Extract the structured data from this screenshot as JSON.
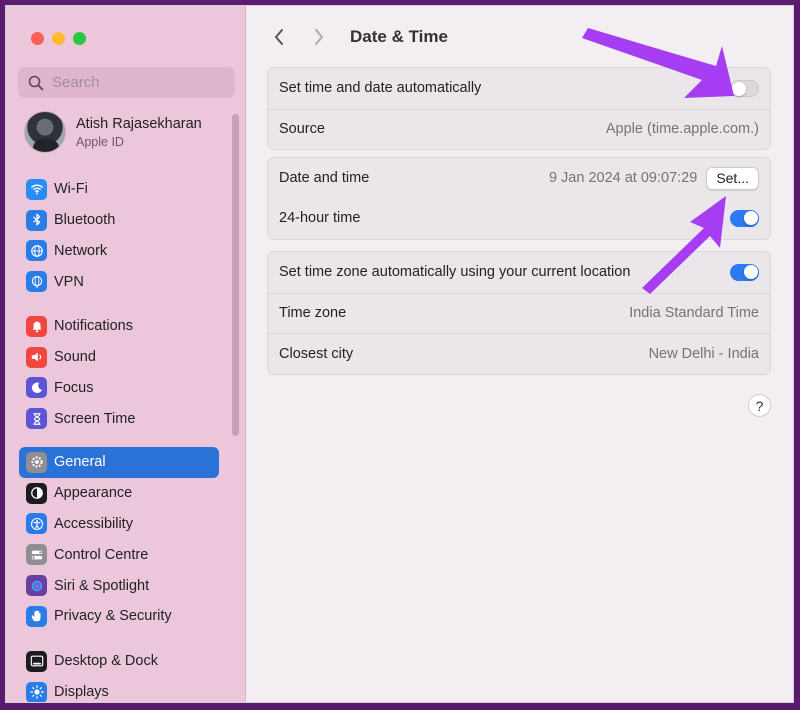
{
  "search": {
    "placeholder": "Search"
  },
  "account": {
    "name": "Atish Rajasekharan",
    "subtitle": "Apple ID"
  },
  "sidebar": {
    "groups": [
      {
        "items": [
          {
            "label": "Wi-Fi",
            "icon": "wifi-icon",
            "color": "#2a8df5"
          },
          {
            "label": "Bluetooth",
            "icon": "bluetooth-icon",
            "color": "#2a7de8"
          },
          {
            "label": "Network",
            "icon": "globe-icon",
            "color": "#2a7de8"
          },
          {
            "label": "VPN",
            "icon": "vpn-globe-icon",
            "color": "#2a7de8"
          }
        ]
      },
      {
        "items": [
          {
            "label": "Notifications",
            "icon": "bell-icon",
            "color": "#f0473f"
          },
          {
            "label": "Sound",
            "icon": "speaker-icon",
            "color": "#f0473f"
          },
          {
            "label": "Focus",
            "icon": "moon-icon",
            "color": "#5e55d6"
          },
          {
            "label": "Screen Time",
            "icon": "hourglass-icon",
            "color": "#5e55d6"
          }
        ]
      },
      {
        "items": [
          {
            "label": "General",
            "icon": "gear-icon",
            "color": "#8e8e93",
            "selected": true
          },
          {
            "label": "Appearance",
            "icon": "appearance-icon",
            "color": "#1c1c1e"
          },
          {
            "label": "Accessibility",
            "icon": "accessibility-icon",
            "color": "#2a7de8"
          },
          {
            "label": "Control Centre",
            "icon": "control-centre-icon",
            "color": "#8e8e93"
          },
          {
            "label": "Siri & Spotlight",
            "icon": "siri-icon",
            "color": "#6b3fa0"
          },
          {
            "label": "Privacy & Security",
            "icon": "hand-icon",
            "color": "#2a7de8"
          }
        ]
      },
      {
        "items": [
          {
            "label": "Desktop & Dock",
            "icon": "dock-icon",
            "color": "#1c1c1e"
          },
          {
            "label": "Displays",
            "icon": "sun-icon",
            "color": "#2a7de8"
          }
        ]
      }
    ]
  },
  "header": {
    "title": "Date & Time"
  },
  "settings": {
    "auto_time": {
      "label": "Set time and date automatically",
      "on": false
    },
    "source": {
      "label": "Source",
      "value": "Apple (time.apple.com.)"
    },
    "date_time": {
      "label": "Date and time",
      "value": "9 Jan 2024 at 09:07:29",
      "button": "Set..."
    },
    "hour24": {
      "label": "24-hour time",
      "on": true
    },
    "auto_zone": {
      "label": "Set time zone automatically using your current location",
      "on": true
    },
    "time_zone": {
      "label": "Time zone",
      "value": "India Standard Time"
    },
    "closest_city": {
      "label": "Closest city",
      "value": "New Delhi - India"
    }
  },
  "help": {
    "label": "?"
  },
  "colors": {
    "accent": "#2a72d6",
    "toggle_on": "#2d7bf2",
    "annotation_arrow": "#a63df2"
  }
}
